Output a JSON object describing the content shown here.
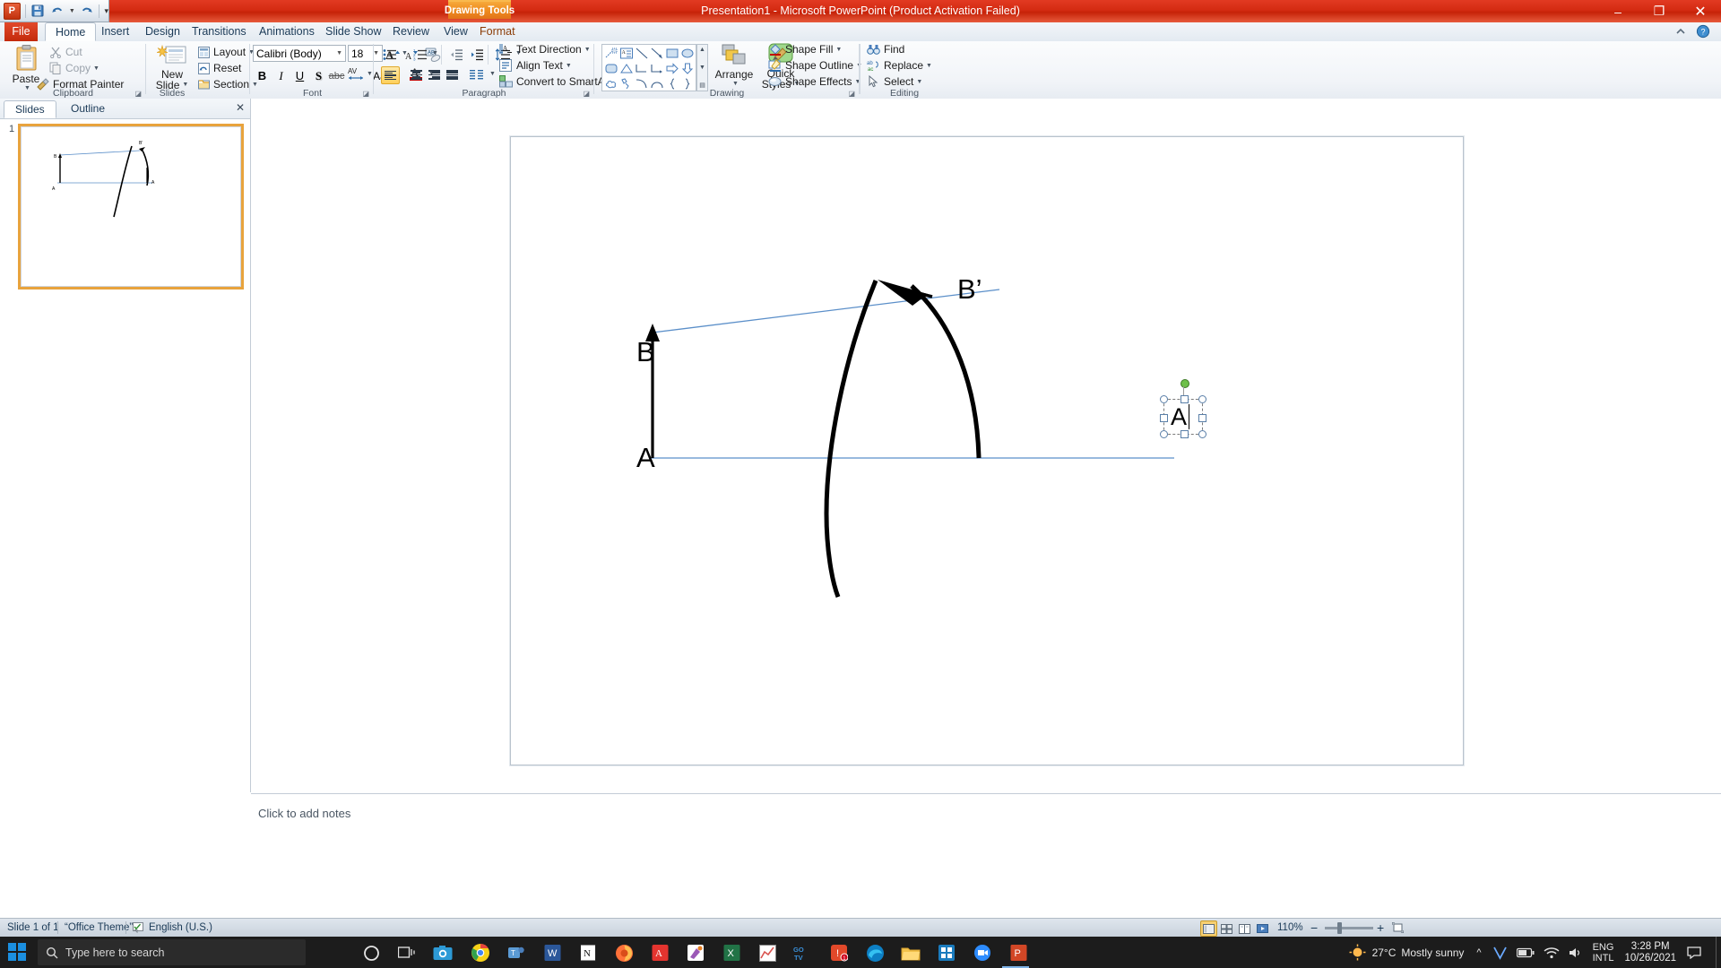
{
  "window": {
    "title": "Presentation1  -  Microsoft PowerPoint (Product Activation Failed)",
    "contextual_tab": "Drawing Tools",
    "minimize": "–",
    "restore": "❐",
    "close": "✕"
  },
  "qat": {
    "app_icon": "P",
    "save_icon": "save-icon",
    "undo_icon": "undo-icon",
    "redo_icon": "redo-icon",
    "more_icon": "customize-qat-icon"
  },
  "tabs": [
    {
      "label": "File",
      "id": "file"
    },
    {
      "label": "Home",
      "id": "home"
    },
    {
      "label": "Insert",
      "id": "insert"
    },
    {
      "label": "Design",
      "id": "design"
    },
    {
      "label": "Transitions",
      "id": "transitions"
    },
    {
      "label": "Animations",
      "id": "animations"
    },
    {
      "label": "Slide Show",
      "id": "slideshow"
    },
    {
      "label": "Review",
      "id": "review"
    },
    {
      "label": "View",
      "id": "view"
    },
    {
      "label": "Format",
      "id": "format"
    }
  ],
  "ribbon": {
    "help_icon": "help-icon",
    "collapse_icon": "minimize-ribbon-icon",
    "groups": {
      "clipboard": {
        "label": "Clipboard",
        "paste": "Paste",
        "cut": "Cut",
        "copy": "Copy",
        "format_painter": "Format Painter"
      },
      "slides": {
        "label": "Slides",
        "new_slide": "New\nSlide",
        "new_slide_l1": "New",
        "new_slide_l2": "Slide",
        "layout": "Layout",
        "reset": "Reset",
        "section": "Section"
      },
      "font": {
        "label": "Font",
        "font_name": "Calibri (Body)",
        "font_size": "18",
        "bold": "B",
        "italic": "I",
        "underline": "U",
        "shadow": "S",
        "strikethrough": "abc",
        "char_spacing": "AV",
        "change_case": "Aa",
        "font_color": "A",
        "grow_font": "A",
        "shrink_font": "A",
        "clear_formatting": "clear-formatting-icon"
      },
      "paragraph": {
        "label": "Paragraph",
        "text_direction": "Text Direction",
        "align_text": "Align Text",
        "convert_to_smartart": "Convert to SmartArt",
        "bullets": "bullets-icon",
        "numbering": "numbering-icon",
        "decrease_indent": "decrease-indent-icon",
        "increase_indent": "increase-indent-icon",
        "line_spacing": "line-spacing-icon",
        "align_left": "align-left-icon",
        "align_center": "align-center-icon",
        "align_right": "align-right-icon",
        "justify": "justify-icon",
        "columns": "columns-icon"
      },
      "drawing": {
        "label": "Drawing",
        "arrange": "Arrange",
        "quick_styles_l1": "Quick",
        "quick_styles_l2": "Styles",
        "shape_fill": "Shape Fill",
        "shape_outline": "Shape Outline",
        "shape_effects": "Shape Effects"
      },
      "editing": {
        "label": "Editing",
        "find": "Find",
        "replace": "Replace",
        "select": "Select"
      }
    }
  },
  "left_pane": {
    "tab_slides": "Slides",
    "tab_outline": "Outline",
    "close_icon": "close-icon",
    "slide_number": "1"
  },
  "notes": {
    "placeholder": "Click to add notes"
  },
  "status_bar": {
    "slide_info": "Slide 1 of 1",
    "theme": "“Office Theme”",
    "language": "English (U.S.)",
    "zoom_level": "110%",
    "spellcheck_icon": "spellcheck-icon",
    "view_normal": "normal-view-icon",
    "view_sorter": "slide-sorter-icon",
    "view_reading": "reading-view-icon",
    "view_slideshow": "slideshow-icon",
    "zoom_out": "−",
    "zoom_in": "+",
    "fit_icon": "fit-slide-icon"
  },
  "taskbar": {
    "start_icon": "windows-start-icon",
    "search_placeholder": "Type here to search",
    "search_icon": "search-icon",
    "weather_temp": "27°C",
    "weather_desc": "Mostly sunny",
    "lang_line1": "ENG",
    "lang_line2": "INTL",
    "time": "3:28 PM",
    "date": "10/26/2021",
    "notification_icon": "action-center-icon",
    "show_desktop": "show-desktop-icon",
    "apps": [
      {
        "name": "cortana-icon"
      },
      {
        "name": "task-view-icon"
      },
      {
        "name": "camera-icon"
      },
      {
        "name": "chrome-icon"
      },
      {
        "name": "teams-icon"
      },
      {
        "name": "word-icon"
      },
      {
        "name": "notion-icon"
      },
      {
        "name": "firefox-icon"
      },
      {
        "name": "acrobat-icon"
      },
      {
        "name": "paint-icon"
      },
      {
        "name": "excel-icon"
      },
      {
        "name": "graph-icon"
      },
      {
        "name": "gotv-icon"
      },
      {
        "name": "alert-icon"
      },
      {
        "name": "edge-icon"
      },
      {
        "name": "explorer-icon"
      },
      {
        "name": "store-icon"
      },
      {
        "name": "zoom-icon"
      },
      {
        "name": "powerpoint-icon"
      }
    ]
  },
  "slide_content": {
    "labels": {
      "B": "B",
      "B_prime": "B’",
      "A": "A",
      "A_prime": "A"
    },
    "selected_textbox_text": "A",
    "selection": {
      "rotate_handle": "rotate-handle",
      "handles": 8
    }
  },
  "colors": {
    "title_red": "#d42b12",
    "context_orange": "#ef8c20",
    "ribbon_bg": "#f1f4f8",
    "accent_blue": "#4a7ebb",
    "slide_line": "#5b8fc9",
    "selection_blue": "#4c8fd4",
    "rotate_green": "#6ec04a",
    "status_bg": "#c8d2dc",
    "taskbar_bg": "#1c1c1c"
  }
}
